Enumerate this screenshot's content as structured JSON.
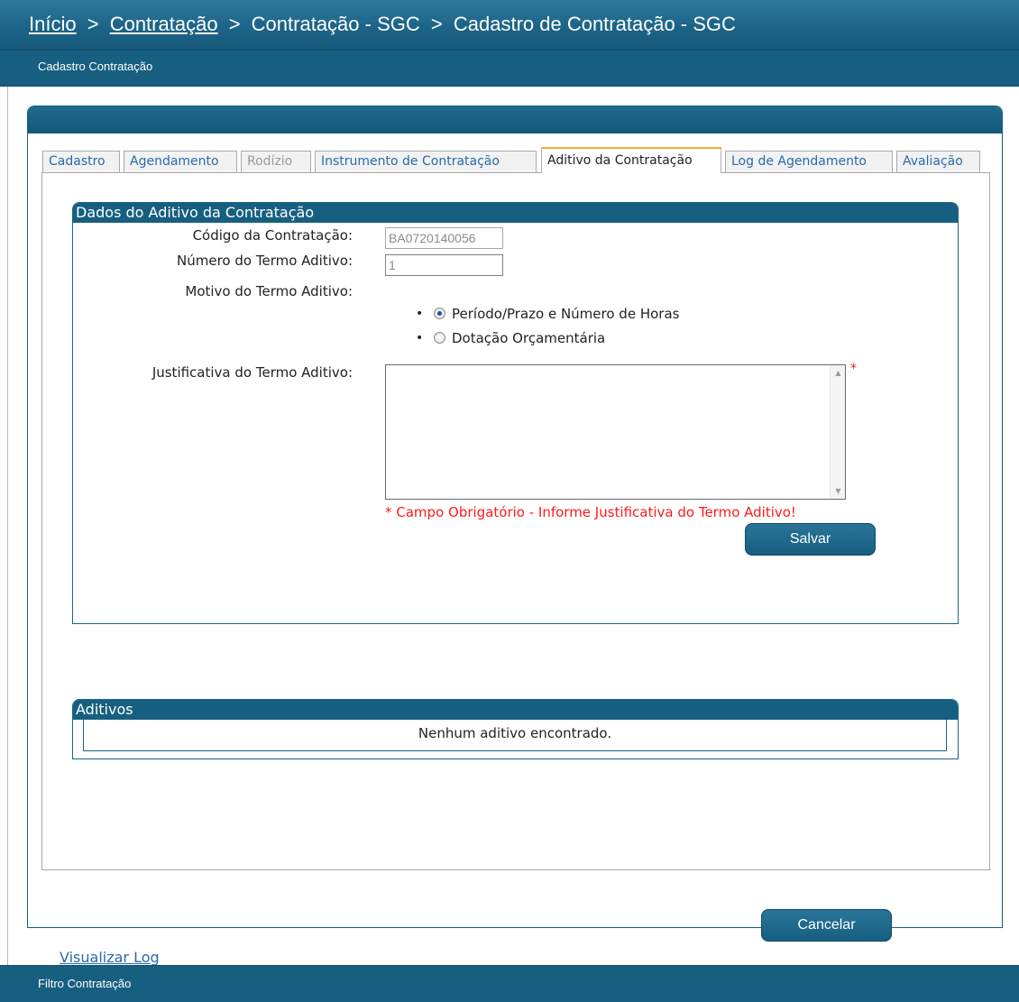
{
  "breadcrumb": {
    "items": [
      "Início",
      "Contratação",
      "Contratação - SGC",
      "Cadastro de Contratação - SGC"
    ],
    "separator": ">"
  },
  "subheader": {
    "title": "Cadastro Contratação"
  },
  "tabs": [
    {
      "label": "Cadastro",
      "state": "normal"
    },
    {
      "label": "Agendamento",
      "state": "normal"
    },
    {
      "label": "Rodízio",
      "state": "disabled"
    },
    {
      "label": "Instrumento de Contratação",
      "state": "normal"
    },
    {
      "label": "Aditivo da Contratação",
      "state": "active"
    },
    {
      "label": "Log de Agendamento",
      "state": "normal"
    },
    {
      "label": "Avaliação",
      "state": "normal"
    }
  ],
  "form": {
    "section_title": "Dados do Aditivo da Contratação",
    "codigo_label": "Código da Contratação:",
    "codigo_value": "BA0720140056",
    "numero_label": "Número do Termo Aditivo:",
    "numero_value": "1",
    "motivo_label": "Motivo do Termo Aditivo:",
    "motivo_options": [
      {
        "label": "Período/Prazo e Número de Horas",
        "checked": true
      },
      {
        "label": "Dotação Orçamentária",
        "checked": false
      }
    ],
    "justificativa_label": "Justificativa do Termo Aditivo:",
    "justificativa_value": "",
    "required_marker": "*",
    "error_message": "* Campo Obrigatório - Informe Justificativa do Termo Aditivo!",
    "save_label": "Salvar"
  },
  "aditivos": {
    "title": "Aditivos",
    "empty_message": "Nenhum aditivo encontrado."
  },
  "actions": {
    "cancel_label": "Cancelar",
    "view_log_label": "Visualizar Log"
  },
  "footer": {
    "title": "Filtro Contratação"
  },
  "colors": {
    "brand_blue": "#175f80",
    "active_tab_accent": "#f1b12e",
    "link": "#2a6aa8",
    "error": "#ff1a1a"
  }
}
